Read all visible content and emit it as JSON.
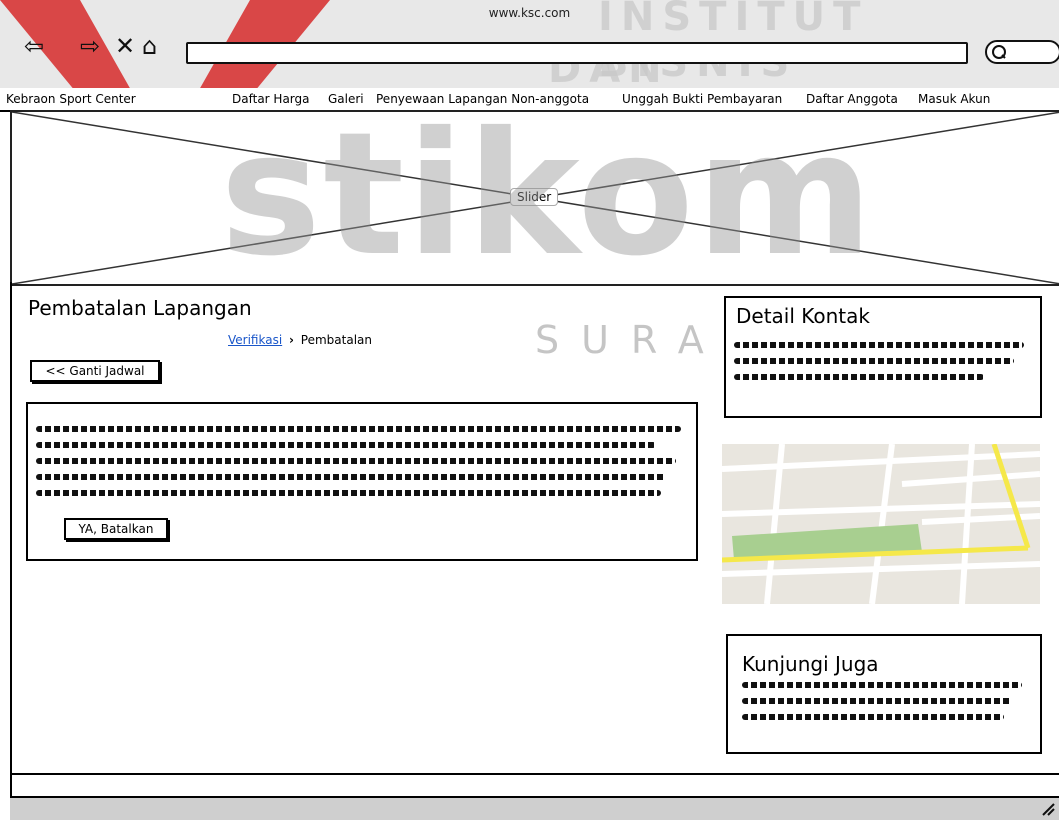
{
  "browser": {
    "url": "www.ksc.com"
  },
  "watermark": {
    "line1": "INSTITUT BISNIS",
    "line2": "DAN INFORMATIKA",
    "logo_word": "stikom",
    "city": "SURABAYA"
  },
  "nav": {
    "brand": "Kebraon Sport Center",
    "items": [
      "Daftar Harga",
      "Galeri",
      "Penyewaan Lapangan Non-anggota",
      "Unggah Bukti Pembayaran",
      "Daftar Anggota",
      "Masuk Akun"
    ]
  },
  "slider": {
    "label": "Slider"
  },
  "main": {
    "title": "Pembatalan Lapangan",
    "breadcrumb": {
      "link": "Verifikasi",
      "separator": "›",
      "current": "Pembatalan"
    },
    "back_button": "<< Ganti Jadwal",
    "confirm_button": "YA, Batalkan"
  },
  "sidebar": {
    "contact_title": "Detail Kontak",
    "visit_title": "Kunjungi Juga"
  },
  "colors": {
    "watermark_red": "#d62a2a",
    "link_blue": "#1a56c9",
    "map_road_yellow": "#f5e84a",
    "map_park_green": "#a8cf90"
  }
}
